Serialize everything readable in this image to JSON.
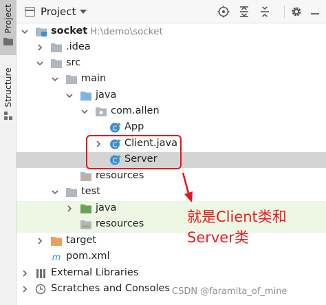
{
  "toolstrip": {
    "project_label": "Project",
    "structure_label": "Structure"
  },
  "header": {
    "title": "Project"
  },
  "tree": {
    "root": {
      "name": "socket",
      "path": "H:\\demo\\socket"
    },
    "idea": "idea",
    "idea_label": ".idea",
    "src": "src",
    "main": "main",
    "java_main": "java",
    "package": "com.allen",
    "app": "App",
    "client": "Client.java",
    "server": "Server",
    "resources_main": "resources",
    "test": "test",
    "java_test": "java",
    "resources_test": "resources",
    "target": "target",
    "pom": "pom.xml",
    "external_libraries": "External Libraries",
    "scratches": "Scratches and Consoles"
  },
  "annotation": {
    "line1": "就是Client类和",
    "line2": "Server类"
  },
  "watermark": "CSDN @faramita_of_mine",
  "colors": {
    "folder": "#b0b7bf",
    "source_folder": "#7fb5dd",
    "test_folder": "#6ca05a",
    "excluded_folder": "#e9a05a",
    "class_icon": "#3c8ed1",
    "highlight_red": "#e8131b"
  }
}
